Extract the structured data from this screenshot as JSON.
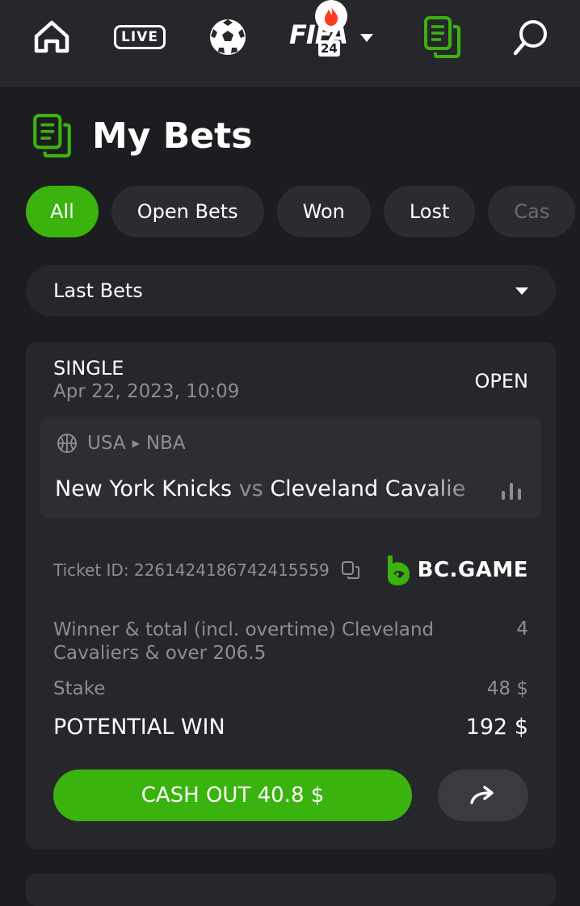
{
  "nav": {
    "items": [
      {
        "name": "home",
        "icon": "home-icon"
      },
      {
        "name": "live",
        "label": "LIVE"
      },
      {
        "name": "soccer",
        "icon": "soccer-ball-icon"
      },
      {
        "name": "fifa",
        "label": "FIFA",
        "sub": "24",
        "badge_icon": "fire-icon"
      },
      {
        "name": "bets",
        "icon": "bets-slip-icon"
      },
      {
        "name": "search",
        "icon": "search-icon"
      }
    ]
  },
  "header": {
    "title": "My Bets",
    "icon": "bets-slip-icon"
  },
  "filters": [
    "All",
    "Open Bets",
    "Won",
    "Lost",
    "Cas"
  ],
  "dropdown": {
    "value": "Last Bets"
  },
  "bet": {
    "type": "SINGLE",
    "date": "Apr 22, 2023, 10:09",
    "status": "OPEN",
    "event": {
      "country": "USA",
      "league": "NBA",
      "home": "New York Knicks",
      "vs": "vs",
      "away": "Cleveland Cavalie"
    },
    "ticket_label": "Ticket ID: 2261424186742415559",
    "brand": "BC.GAME",
    "selection": "Winner & total (incl. overtime) Cleveland Cavaliers & over 206.5",
    "odds": "4",
    "stake_label": "Stake",
    "stake_value": "48 $",
    "win_label": "POTENTIAL WIN",
    "win_value": "192 $",
    "cashout_label": "CASH OUT 40.8 $"
  },
  "colors": {
    "accent": "#3bb30f",
    "background": "#1c1d20",
    "card": "#26272b",
    "muted": "#8d8e93"
  }
}
